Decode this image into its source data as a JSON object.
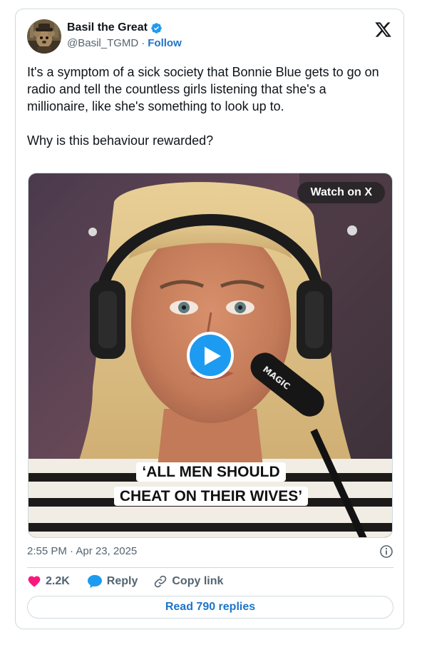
{
  "author": {
    "display_name": "Basil the Great",
    "handle": "@Basil_TGMD",
    "separator": "·",
    "follow_label": "Follow"
  },
  "tweet": {
    "text": "It's a symptom of a sick society that Bonnie Blue gets to go on radio and tell the countless girls listening that she's a millionaire, like she's something to look up to.\n\nWhy is this behaviour rewarded?",
    "timestamp": "2:55 PM · Apr 23, 2025"
  },
  "media": {
    "watch_label": "Watch on X",
    "caption_line_1": "‘ALL MEN SHOULD",
    "caption_line_2": "CHEAT ON THEIR WIVES’",
    "mic_text": "MAGIC"
  },
  "actions": {
    "like_count": "2.2K",
    "reply_label": "Reply",
    "copy_link_label": "Copy link",
    "read_replies_label": "Read 790 replies"
  },
  "icons": {
    "verified": "verified-badge-icon",
    "x_logo": "x-logo-icon",
    "play": "play-icon",
    "info": "info-icon",
    "heart": "heart-icon",
    "reply": "reply-bubble-icon",
    "link": "link-icon"
  },
  "colors": {
    "accent_blue": "#1d9bf0",
    "link_blue": "#1d74c9",
    "heart_pink": "#f91880",
    "muted_text": "#536471",
    "border": "#cfd9de"
  }
}
